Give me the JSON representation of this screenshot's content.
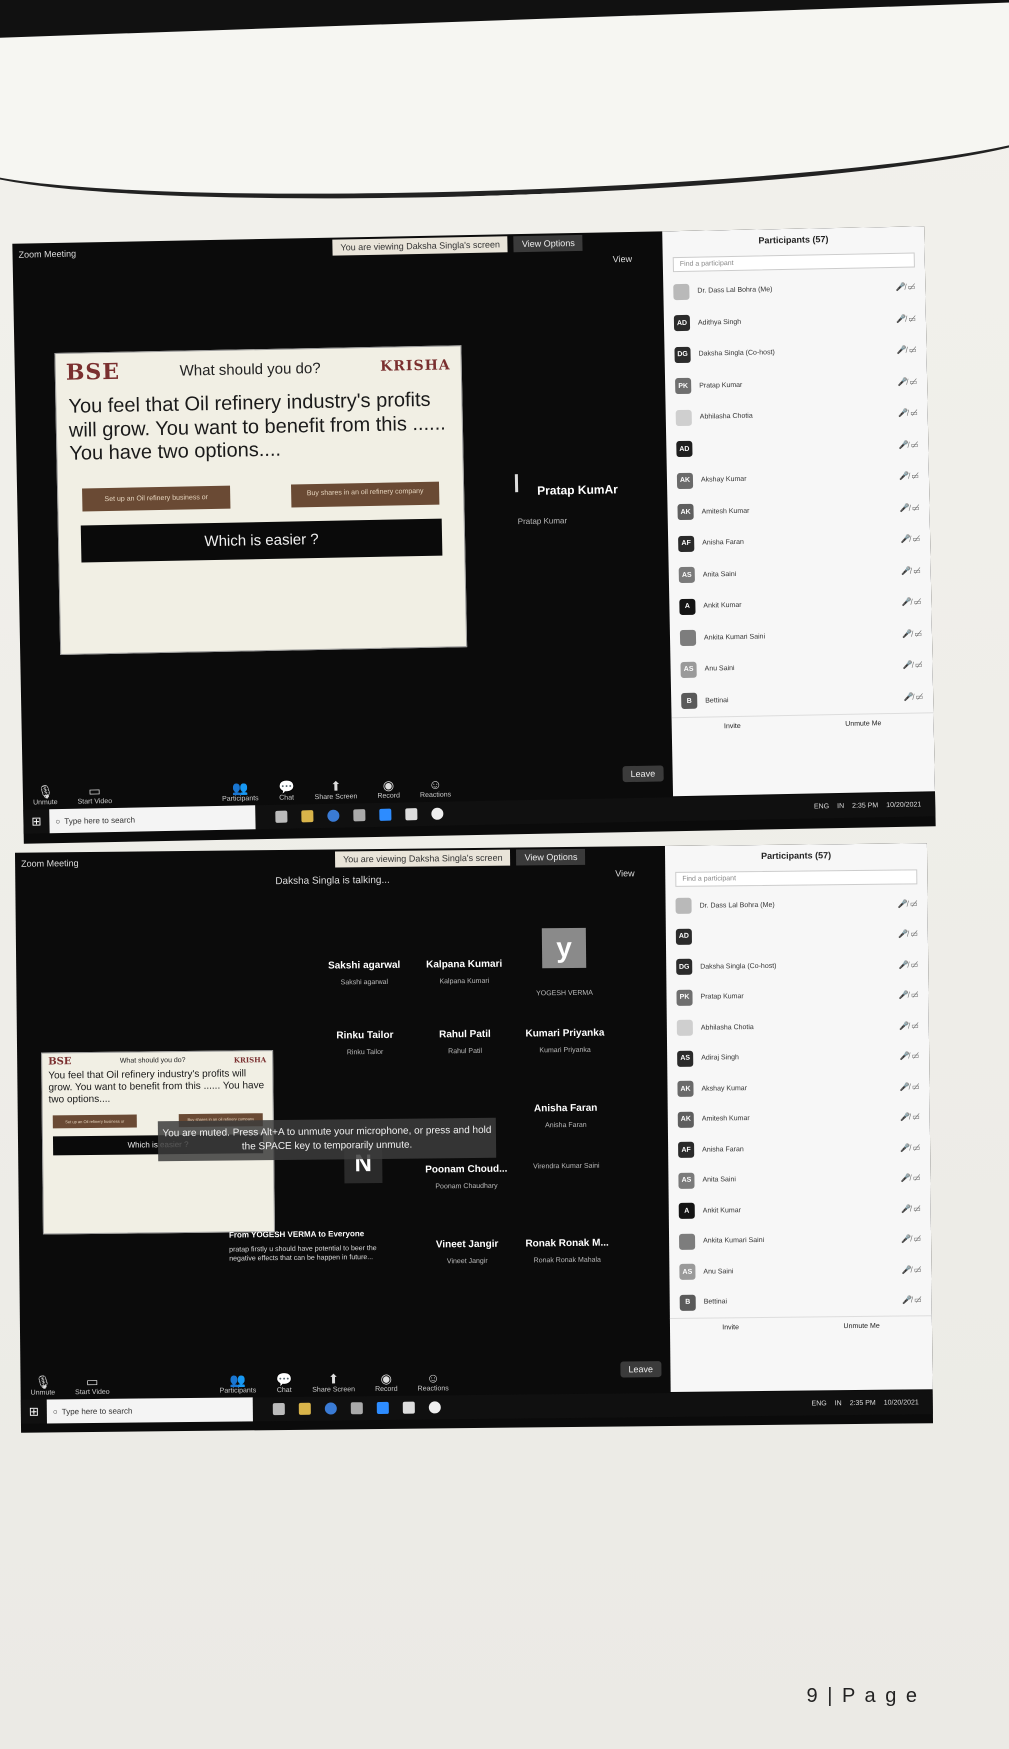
{
  "shared": {
    "banner_text": "You are viewing Daksha Singla's screen",
    "view_options": "View Options",
    "view_label": "View",
    "participants_title": "Participants (57)",
    "search_placeholder": "Find a participant",
    "invite": "Invite",
    "unmute_me": "Unmute Me",
    "leave": "Leave",
    "taskbar_search": "Type here to search",
    "tray_lang": "ENG",
    "tray_region": "IN",
    "tray_time": "2:35 PM",
    "tray_date": "10/20/2021"
  },
  "toolbar": [
    {
      "label": "Unmute",
      "icon": "mic-icon"
    },
    {
      "label": "Start Video",
      "icon": "camera-icon"
    },
    {
      "label": "Participants",
      "icon": "participants-icon",
      "count": "57"
    },
    {
      "label": "Chat",
      "icon": "chat-icon"
    },
    {
      "label": "Share Screen",
      "icon": "share-icon"
    },
    {
      "label": "Record",
      "icon": "record-icon"
    },
    {
      "label": "Reactions",
      "icon": "reactions-icon"
    }
  ],
  "slide": {
    "logo_left": "BSE",
    "question": "What should you do?",
    "logo_right": "KRISHA",
    "body": "You feel that Oil refinery industry's profits will grow. You want to benefit from this ...... You have two options....",
    "option1": "Set up an Oil refinery business or",
    "option2": "Buy shares in an oil refinery company",
    "easier": "Which is easier ?"
  },
  "screen1": {
    "window_title": "Zoom Meeting",
    "speaker_name": "Pratap KumAr",
    "speaker_sub": "Pratap Kumar",
    "participants": [
      {
        "initials": "",
        "name": "Dr. Dass Lal Bohra (Me)",
        "color": "#b9b9b9"
      },
      {
        "initials": "AD",
        "name": "Adithya Singh",
        "color": "#2b2b2b"
      },
      {
        "initials": "DG",
        "name": "Daksha Singla (Co-host)",
        "color": "#2b2b2b"
      },
      {
        "initials": "PK",
        "name": "Pratap Kumar",
        "color": "#6f6f6f"
      },
      {
        "initials": "",
        "name": "Abhilasha Chotia",
        "color": "#cfcfcf"
      },
      {
        "initials": "AD",
        "name": "",
        "color": "#1f1f1f"
      },
      {
        "initials": "AK",
        "name": "Akshay Kumar",
        "color": "#6a6a6a"
      },
      {
        "initials": "AK",
        "name": "Amitesh Kumar",
        "color": "#5f5f5f"
      },
      {
        "initials": "AF",
        "name": "Anisha Faran",
        "color": "#2a2a2a"
      },
      {
        "initials": "AS",
        "name": "Anita Saini",
        "color": "#7a7a7a"
      },
      {
        "initials": "A",
        "name": "Ankit Kumar",
        "color": "#141414"
      },
      {
        "initials": "",
        "name": "Ankita Kumari Saini",
        "color": "#7d7d7d"
      },
      {
        "initials": "AS",
        "name": "Anu Saini",
        "color": "#9a9a9a"
      },
      {
        "initials": "B",
        "name": "Bettinai",
        "color": "#5a5a5a"
      }
    ]
  },
  "screen2": {
    "window_title": "Zoom Meeting",
    "speaker_label": "Daksha Singla is talking...",
    "muted_tip": "You are muted. Press Alt+A to unmute your microphone, or press and hold the SPACE key to temporarily unmute.",
    "chat_from": "From YOGESH VERMA to Everyone",
    "chat_msg": "pratap firstly u should have potential to beer the negative effects that can be happen in future...",
    "tiles": [
      {
        "name": "Sakshi agarwal",
        "sub": "Sakshi agarwal"
      },
      {
        "name": "Kalpana Kumari",
        "sub": "Kalpana Kumari"
      },
      {
        "name": "",
        "sub": "YOGESH VERMA",
        "avatar": "y"
      },
      {
        "name": "Rinku Tailor",
        "sub": "Rinku Tailor"
      },
      {
        "name": "Rahul Patil",
        "sub": "Rahul Patil"
      },
      {
        "name": "Kumari Priyanka",
        "sub": "Kumari Priyanka"
      },
      {
        "name": "",
        "sub": ""
      },
      {
        "name": "",
        "sub": ""
      },
      {
        "name": "Anisha Faran",
        "sub": "Anisha Faran"
      },
      {
        "name": "",
        "sub": "",
        "avatar": "N"
      },
      {
        "name": "Poonam Choud...",
        "sub": "Poonam Chaudhary"
      },
      {
        "name": "",
        "sub": "Virendra Kumar Saini"
      },
      {
        "name": "",
        "sub": ""
      },
      {
        "name": "Vineet Jangir",
        "sub": "Vineet Jangir"
      },
      {
        "name": "Ronak Ronak M...",
        "sub": "Ronak Ronak Mahala"
      }
    ],
    "participants": [
      {
        "initials": "",
        "name": "Dr. Dass Lal Bohra (Me)",
        "color": "#b9b9b9"
      },
      {
        "initials": "AD",
        "name": "",
        "color": "#2b2b2b"
      },
      {
        "initials": "DG",
        "name": "Daksha Singla (Co-host)",
        "color": "#2b2b2b"
      },
      {
        "initials": "PK",
        "name": "Pratap Kumar",
        "color": "#6f6f6f"
      },
      {
        "initials": "",
        "name": "Abhilasha Chotia",
        "color": "#cfcfcf"
      },
      {
        "initials": "AS",
        "name": "Adiraj Singh",
        "color": "#2b2b2b"
      },
      {
        "initials": "AK",
        "name": "Akshay Kumar",
        "color": "#6a6a6a"
      },
      {
        "initials": "AK",
        "name": "Amitesh Kumar",
        "color": "#5f5f5f"
      },
      {
        "initials": "AF",
        "name": "Anisha Faran",
        "color": "#2a2a2a"
      },
      {
        "initials": "AS",
        "name": "Anita Saini",
        "color": "#7a7a7a"
      },
      {
        "initials": "A",
        "name": "Ankit Kumar",
        "color": "#141414"
      },
      {
        "initials": "",
        "name": "Ankita Kumari Saini",
        "color": "#7d7d7d"
      },
      {
        "initials": "AS",
        "name": "Anu Saini",
        "color": "#9a9a9a"
      },
      {
        "initials": "B",
        "name": "Bettinai",
        "color": "#5a5a5a"
      }
    ]
  },
  "footer": {
    "page": "9 | P a g e"
  }
}
